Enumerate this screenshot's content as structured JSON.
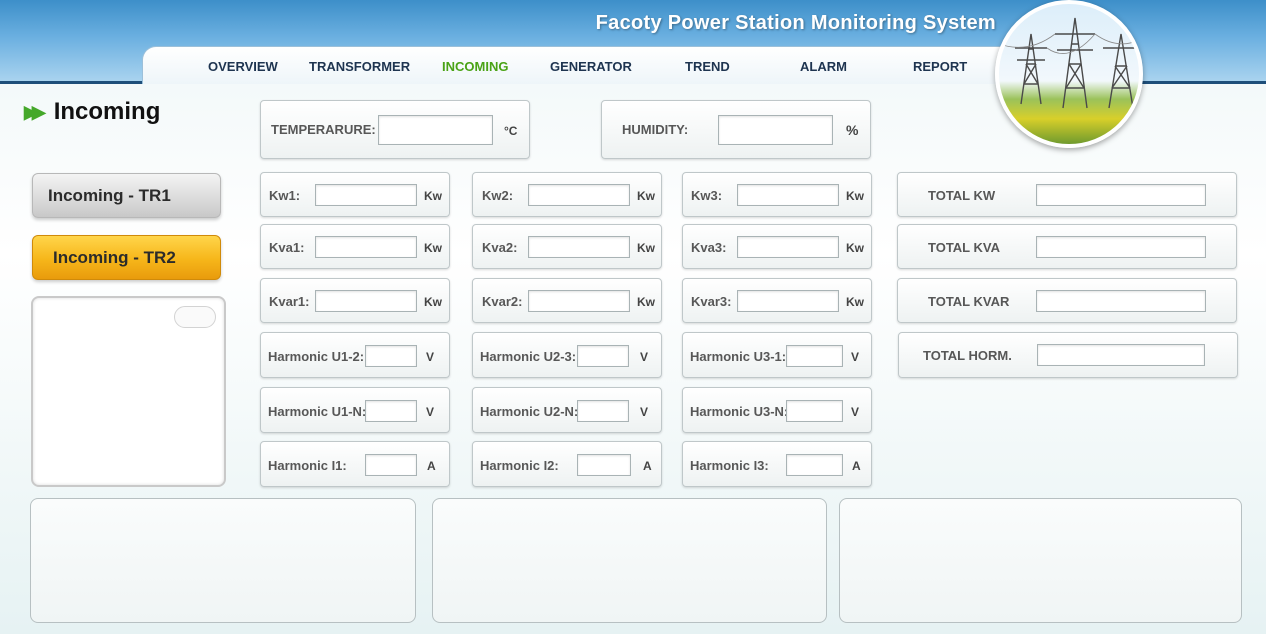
{
  "app_title": "Facoty Power Station Monitoring System",
  "nav": [
    {
      "label": "OVERVIEW",
      "active": false
    },
    {
      "label": "TRANSFORMER",
      "active": false
    },
    {
      "label": "INCOMING",
      "active": true
    },
    {
      "label": "GENERATOR",
      "active": false
    },
    {
      "label": "TREND",
      "active": false
    },
    {
      "label": "ALARM",
      "active": false
    },
    {
      "label": "REPORT",
      "active": false
    }
  ],
  "page": {
    "title": "Incoming",
    "title_icon": "double-arrow-icon"
  },
  "side": {
    "btn_tr1": "Incoming - TR1",
    "btn_tr2": "Incoming - TR2"
  },
  "env": {
    "temperature": {
      "label": "TEMPERARURE:",
      "value": "",
      "unit": "°C"
    },
    "humidity": {
      "label": "HUMIDITY:",
      "value": "",
      "unit": "%"
    }
  },
  "grid": [
    [
      {
        "label": "Kw1:",
        "value": "",
        "unit": "Kw"
      },
      {
        "label": "Kw2:",
        "value": "",
        "unit": "Kw"
      },
      {
        "label": "Kw3:",
        "value": "",
        "unit": "Kw"
      }
    ],
    [
      {
        "label": "Kva1:",
        "value": "",
        "unit": "Kw"
      },
      {
        "label": "Kva2:",
        "value": "",
        "unit": "Kw"
      },
      {
        "label": "Kva3:",
        "value": "",
        "unit": "Kw"
      }
    ],
    [
      {
        "label": "Kvar1:",
        "value": "",
        "unit": "Kw"
      },
      {
        "label": "Kvar2:",
        "value": "",
        "unit": "Kw"
      },
      {
        "label": "Kvar3:",
        "value": "",
        "unit": "Kw"
      }
    ],
    [
      {
        "label": "Harmonic U1-2:",
        "value": "",
        "unit": "V"
      },
      {
        "label": "Harmonic U2-3:",
        "value": "",
        "unit": "V"
      },
      {
        "label": "Harmonic U3-1:",
        "value": "",
        "unit": "V"
      }
    ],
    [
      {
        "label": "Harmonic U1-N:",
        "value": "",
        "unit": "V"
      },
      {
        "label": "Harmonic U2-N:",
        "value": "",
        "unit": "V"
      },
      {
        "label": "Harmonic U3-N:",
        "value": "",
        "unit": "V"
      }
    ],
    [
      {
        "label": "Harmonic I1:",
        "value": "",
        "unit": "A"
      },
      {
        "label": "Harmonic I2:",
        "value": "",
        "unit": "A"
      },
      {
        "label": "Harmonic I3:",
        "value": "",
        "unit": "A"
      }
    ]
  ],
  "totals": [
    {
      "label": "TOTAL KW",
      "value": ""
    },
    {
      "label": "TOTAL KVA",
      "value": ""
    },
    {
      "label": "TOTAL KVAR",
      "value": ""
    },
    {
      "label": "TOTAL HORM.",
      "value": ""
    }
  ],
  "colors": {
    "accent_green": "#4aa316",
    "active_button": "#f6b61a",
    "header_blue": "#3d8fc9"
  }
}
